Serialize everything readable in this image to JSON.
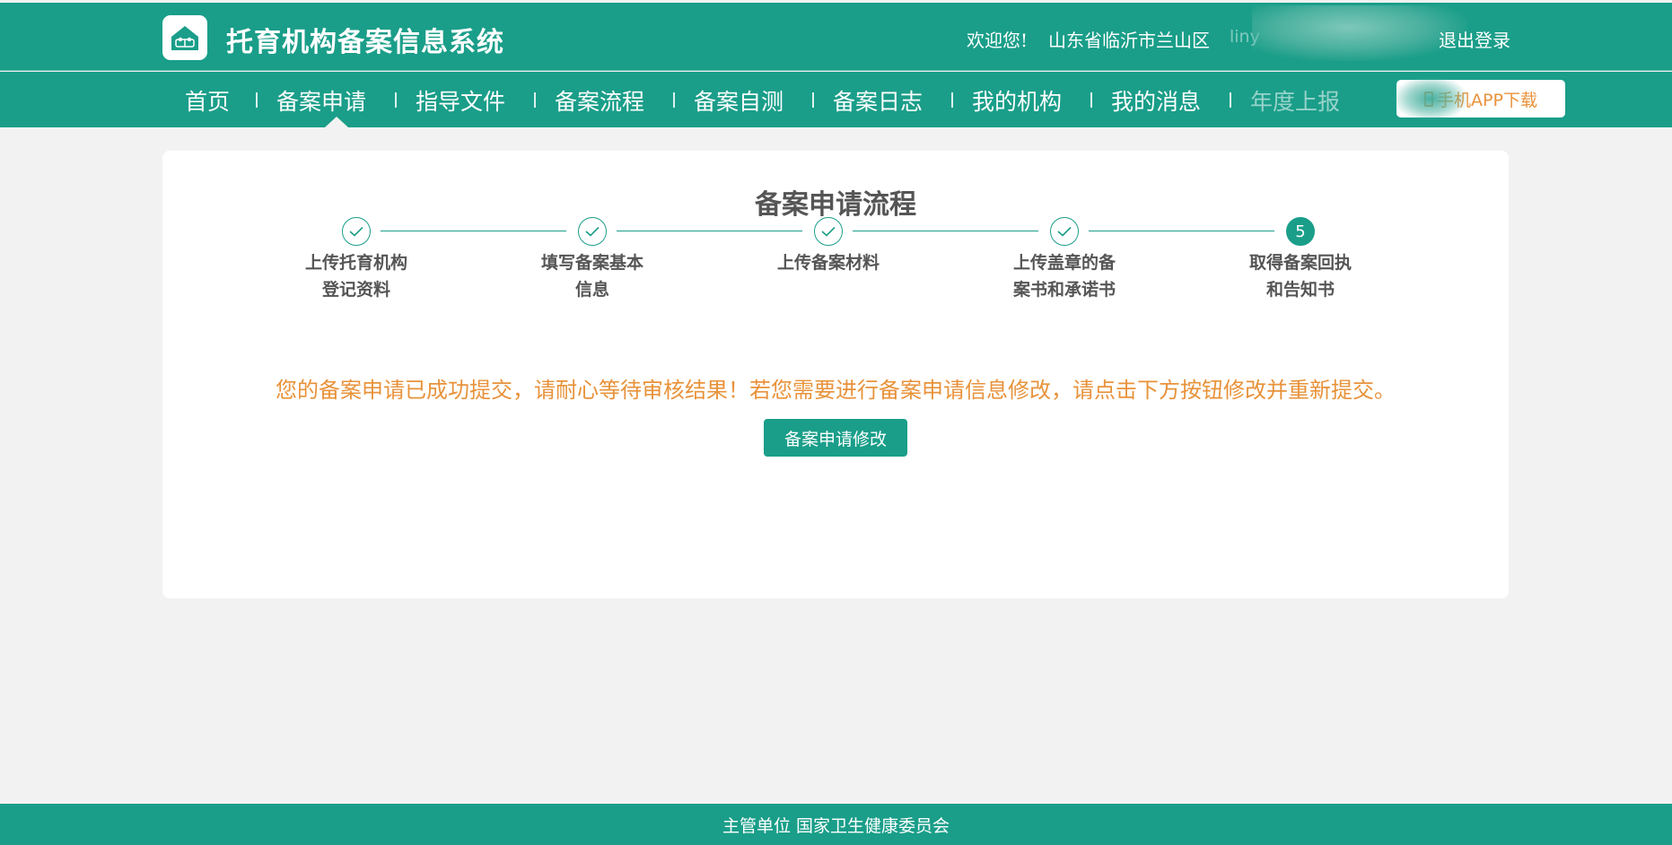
{
  "header": {
    "title": "托育机构备案信息系统",
    "logo_icon": "house-icon",
    "welcome": "欢迎您!",
    "region": "山东省临沂市兰山区",
    "username": "liny",
    "logout_label": "退出登录"
  },
  "nav": {
    "items": [
      {
        "label": "首页"
      },
      {
        "label": "备案申请"
      },
      {
        "label": "指导文件"
      },
      {
        "label": "备案流程"
      },
      {
        "label": "备案自测"
      },
      {
        "label": "备案日志"
      },
      {
        "label": "我的机构"
      },
      {
        "label": "我的消息"
      },
      {
        "label": "年度上报"
      }
    ],
    "active_item": "备案申请",
    "app_download_label": "手机APP下载"
  },
  "process": {
    "title": "备案申请流程",
    "steps": [
      {
        "line1": "上传托育机构",
        "line2": "登记资料",
        "status": "done"
      },
      {
        "line1": "填写备案基本",
        "line2": "信息",
        "status": "done"
      },
      {
        "line1": "上传备案材料",
        "line2": "",
        "status": "done"
      },
      {
        "line1": "上传盖章的备",
        "line2": "案书和承诺书",
        "status": "done"
      },
      {
        "line1": "取得备案回执",
        "line2": "和告知书",
        "status": "current",
        "number": "5"
      }
    ]
  },
  "notice": "您的备案申请已成功提交，请耐心等待审核结果！若您需要进行备案申请信息修改，请点击下方按钮修改并重新提交。",
  "modify_button_label": "备案申请修改",
  "footer": {
    "text": "主管单位 国家卫生健康委员会"
  },
  "colors": {
    "primary": "#1a9e89",
    "accent": "#e8923a",
    "background": "#f2f2f2"
  }
}
